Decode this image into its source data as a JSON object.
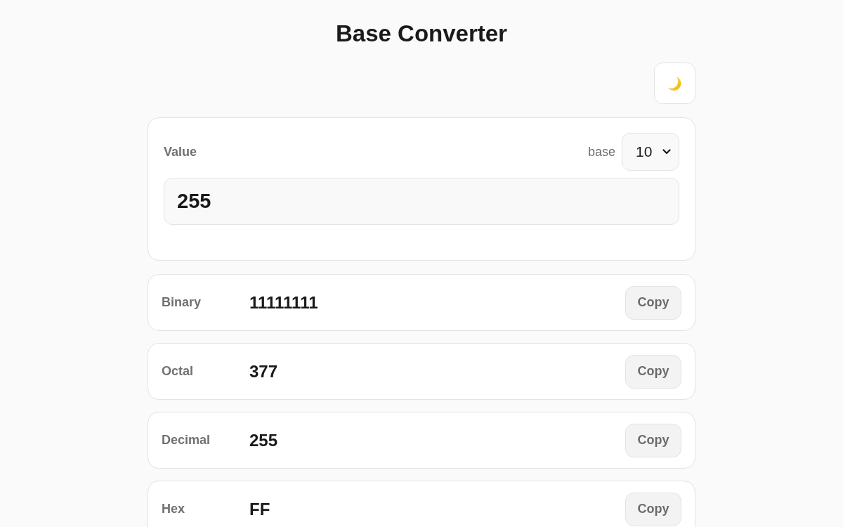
{
  "header": {
    "title": "Base Converter"
  },
  "theme_toggle": {
    "dark_mode": false
  },
  "input_card": {
    "label": "Value",
    "base_label": "base",
    "base_value": "10",
    "value": "255"
  },
  "results": [
    {
      "label": "Binary",
      "value": "11111111",
      "button": "Copy"
    },
    {
      "label": "Octal",
      "value": "377",
      "button": "Copy"
    },
    {
      "label": "Decimal",
      "value": "255",
      "button": "Copy"
    },
    {
      "label": "Hex",
      "value": "FF",
      "button": "Copy"
    }
  ]
}
